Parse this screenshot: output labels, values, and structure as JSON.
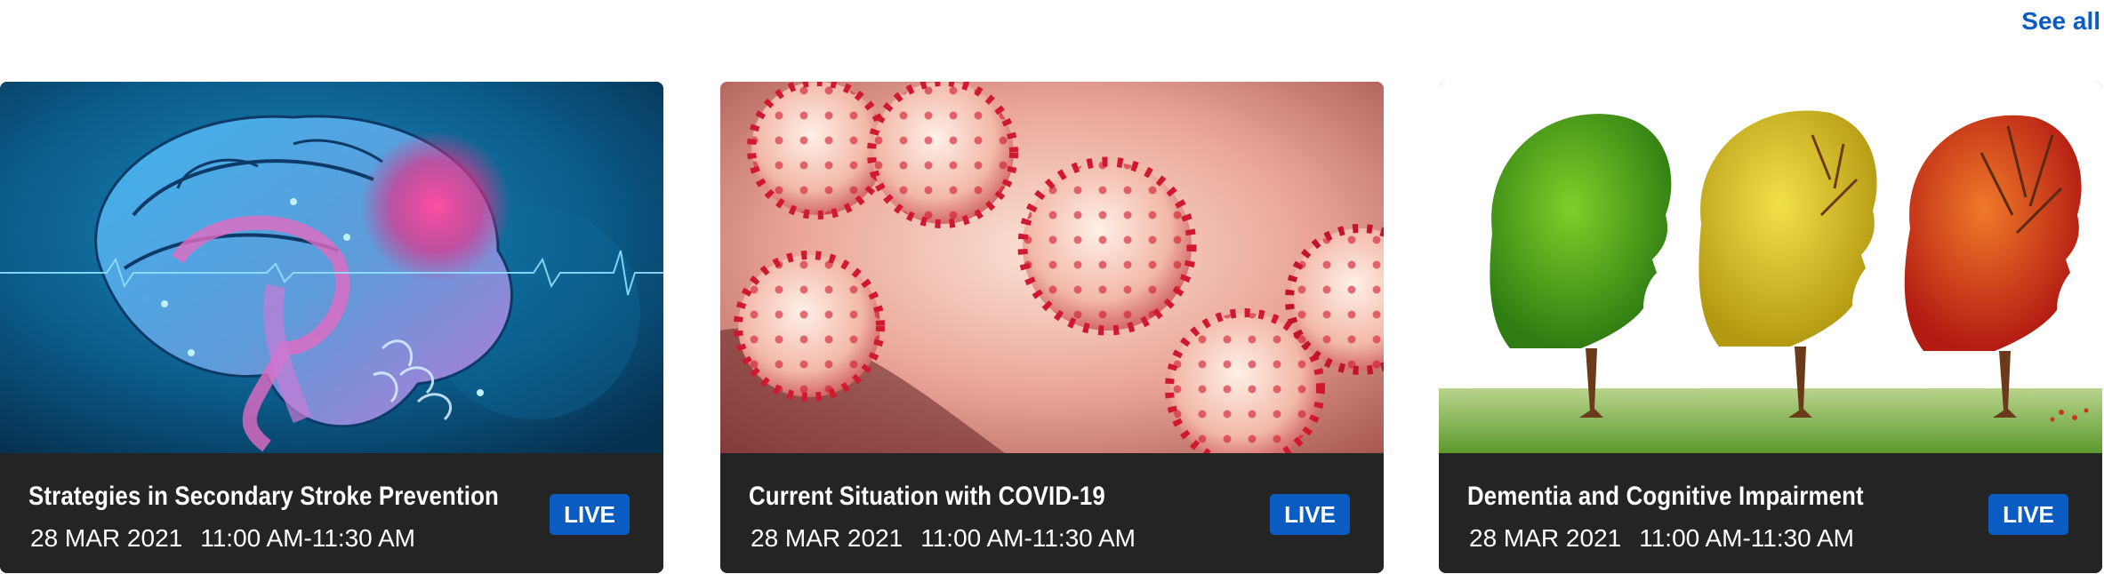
{
  "header": {
    "see_all_label": "See all"
  },
  "cards": [
    {
      "title": "Strategies in Secondary Stroke Prevention",
      "date": "28 MAR 2021",
      "time": "11:00 AM-11:30 AM",
      "badge": "LIVE",
      "image": "brain-illustration"
    },
    {
      "title": "Current Situation with COVID-19",
      "date": "28 MAR 2021",
      "time": "11:00 AM-11:30 AM",
      "badge": "LIVE",
      "image": "coronavirus-illustration"
    },
    {
      "title": "Dementia and Cognitive Impairment",
      "date": "28 MAR 2021",
      "time": "11:00 AM-11:30 AM",
      "badge": "LIVE",
      "image": "tree-heads-illustration"
    }
  ],
  "colors": {
    "accent": "#0b5cc2",
    "card_footer": "#242424",
    "text": "#ffffff"
  }
}
